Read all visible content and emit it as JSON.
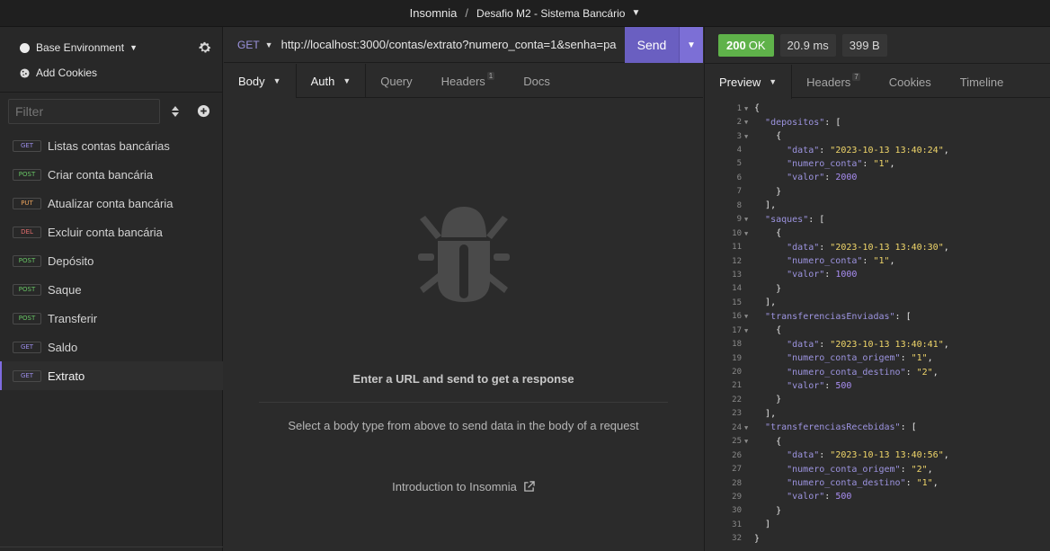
{
  "titlebar": {
    "app": "Insomnia",
    "separator": "/",
    "workspace": "Desafio M2 - Sistema Bancário"
  },
  "sidebar": {
    "environment": "Base Environment",
    "add_cookies": "Add Cookies",
    "filter_placeholder": "Filter",
    "requests": [
      {
        "method": "GET",
        "name": "Listas contas bancárias"
      },
      {
        "method": "POST",
        "name": "Criar conta bancária"
      },
      {
        "method": "PUT",
        "name": "Atualizar conta bancária"
      },
      {
        "method": "DEL",
        "name": "Excluir conta bancária"
      },
      {
        "method": "POST",
        "name": "Depósito"
      },
      {
        "method": "POST",
        "name": "Saque"
      },
      {
        "method": "POST",
        "name": "Transferir"
      },
      {
        "method": "GET",
        "name": "Saldo"
      },
      {
        "method": "GET",
        "name": "Extrato"
      }
    ],
    "active_request": "Extrato"
  },
  "request": {
    "method": "GET",
    "url": "http://localhost:3000/contas/extrato?numero_conta=1&senha=pa",
    "send_label": "Send",
    "tabs": {
      "body": "Body",
      "auth": "Auth",
      "query": "Query",
      "headers": "Headers",
      "headers_count": "1",
      "docs": "Docs"
    },
    "empty_title": "Enter a URL and send to get a response",
    "empty_subtitle": "Select a body type from above to send data in the body of a request",
    "intro_link": "Introduction to Insomnia"
  },
  "response": {
    "status_code": "200",
    "status_text": "OK",
    "time": "20.9 ms",
    "size": "399 B",
    "tabs": {
      "preview": "Preview",
      "headers": "Headers",
      "headers_count": "7",
      "cookies": "Cookies",
      "timeline": "Timeline"
    },
    "code_lines": [
      {
        "n": "1",
        "fold": true,
        "indent": "",
        "k": "",
        "v": "",
        "t": "{"
      },
      {
        "n": "2",
        "fold": true,
        "indent": "  ",
        "k": "\"depositos\"",
        "v": "",
        "t": ": ["
      },
      {
        "n": "3",
        "fold": true,
        "indent": "    ",
        "k": "",
        "v": "",
        "t": "{"
      },
      {
        "n": "4",
        "fold": false,
        "indent": "      ",
        "k": "\"data\"",
        "v": "\"2023-10-13 13:40:24\"",
        "t": ","
      },
      {
        "n": "5",
        "fold": false,
        "indent": "      ",
        "k": "\"numero_conta\"",
        "v": "\"1\"",
        "t": ","
      },
      {
        "n": "6",
        "fold": false,
        "indent": "      ",
        "k": "\"valor\"",
        "num": "2000",
        "t": ""
      },
      {
        "n": "7",
        "fold": false,
        "indent": "    ",
        "k": "",
        "v": "",
        "t": "}"
      },
      {
        "n": "8",
        "fold": false,
        "indent": "  ",
        "k": "",
        "v": "",
        "t": "],"
      },
      {
        "n": "9",
        "fold": true,
        "indent": "  ",
        "k": "\"saques\"",
        "v": "",
        "t": ": ["
      },
      {
        "n": "10",
        "fold": true,
        "indent": "    ",
        "k": "",
        "v": "",
        "t": "{"
      },
      {
        "n": "11",
        "fold": false,
        "indent": "      ",
        "k": "\"data\"",
        "v": "\"2023-10-13 13:40:30\"",
        "t": ","
      },
      {
        "n": "12",
        "fold": false,
        "indent": "      ",
        "k": "\"numero_conta\"",
        "v": "\"1\"",
        "t": ","
      },
      {
        "n": "13",
        "fold": false,
        "indent": "      ",
        "k": "\"valor\"",
        "num": "1000",
        "t": ""
      },
      {
        "n": "14",
        "fold": false,
        "indent": "    ",
        "k": "",
        "v": "",
        "t": "}"
      },
      {
        "n": "15",
        "fold": false,
        "indent": "  ",
        "k": "",
        "v": "",
        "t": "],"
      },
      {
        "n": "16",
        "fold": true,
        "indent": "  ",
        "k": "\"transferenciasEnviadas\"",
        "v": "",
        "t": ": ["
      },
      {
        "n": "17",
        "fold": true,
        "indent": "    ",
        "k": "",
        "v": "",
        "t": "{"
      },
      {
        "n": "18",
        "fold": false,
        "indent": "      ",
        "k": "\"data\"",
        "v": "\"2023-10-13 13:40:41\"",
        "t": ","
      },
      {
        "n": "19",
        "fold": false,
        "indent": "      ",
        "k": "\"numero_conta_origem\"",
        "v": "\"1\"",
        "t": ","
      },
      {
        "n": "20",
        "fold": false,
        "indent": "      ",
        "k": "\"numero_conta_destino\"",
        "v": "\"2\"",
        "t": ","
      },
      {
        "n": "21",
        "fold": false,
        "indent": "      ",
        "k": "\"valor\"",
        "num": "500",
        "t": ""
      },
      {
        "n": "22",
        "fold": false,
        "indent": "    ",
        "k": "",
        "v": "",
        "t": "}"
      },
      {
        "n": "23",
        "fold": false,
        "indent": "  ",
        "k": "",
        "v": "",
        "t": "],"
      },
      {
        "n": "24",
        "fold": true,
        "indent": "  ",
        "k": "\"transferenciasRecebidas\"",
        "v": "",
        "t": ": ["
      },
      {
        "n": "25",
        "fold": true,
        "indent": "    ",
        "k": "",
        "v": "",
        "t": "{"
      },
      {
        "n": "26",
        "fold": false,
        "indent": "      ",
        "k": "\"data\"",
        "v": "\"2023-10-13 13:40:56\"",
        "t": ","
      },
      {
        "n": "27",
        "fold": false,
        "indent": "      ",
        "k": "\"numero_conta_origem\"",
        "v": "\"2\"",
        "t": ","
      },
      {
        "n": "28",
        "fold": false,
        "indent": "      ",
        "k": "\"numero_conta_destino\"",
        "v": "\"1\"",
        "t": ","
      },
      {
        "n": "29",
        "fold": false,
        "indent": "      ",
        "k": "\"valor\"",
        "num": "500",
        "t": ""
      },
      {
        "n": "30",
        "fold": false,
        "indent": "    ",
        "k": "",
        "v": "",
        "t": "}"
      },
      {
        "n": "31",
        "fold": false,
        "indent": "  ",
        "k": "",
        "v": "",
        "t": "]"
      },
      {
        "n": "32",
        "fold": false,
        "indent": "",
        "k": "",
        "v": "",
        "t": "}"
      }
    ]
  }
}
